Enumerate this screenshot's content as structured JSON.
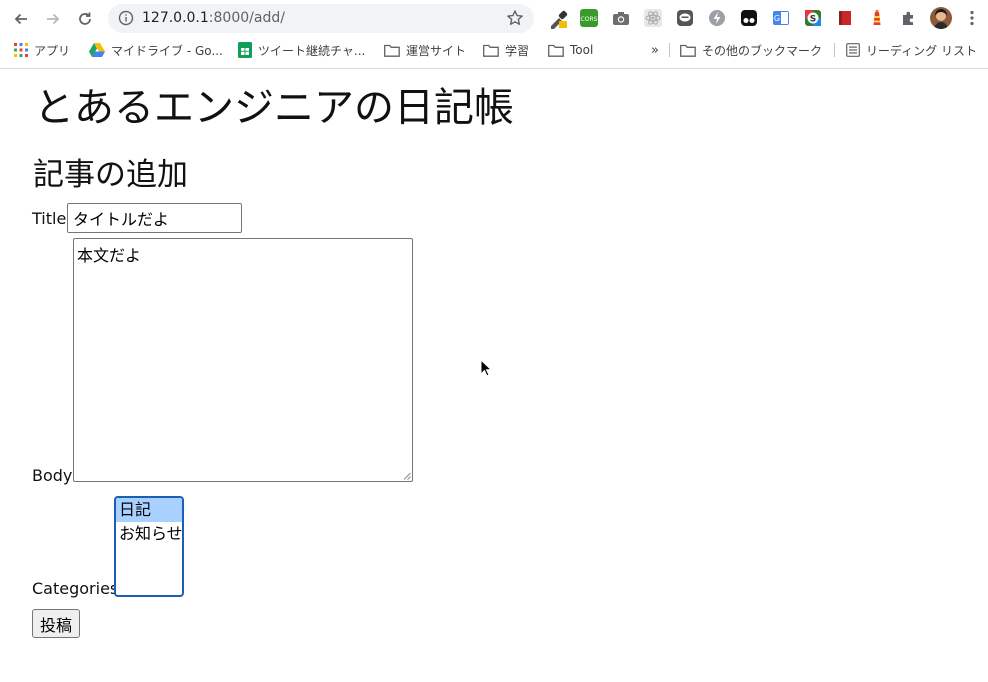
{
  "browser": {
    "url_host": "127.0.0.1",
    "url_path": ":8000/add/",
    "bookmarks": [
      {
        "label": "アプリ",
        "icon": "apps-grid-icon"
      },
      {
        "label": "マイドライブ - Go...",
        "icon": "google-drive-icon"
      },
      {
        "label": "ツイート継続チャ...",
        "icon": "google-sheets-icon"
      },
      {
        "label": "運営サイト",
        "icon": "folder-icon"
      },
      {
        "label": "学習",
        "icon": "folder-icon"
      },
      {
        "label": "Tool",
        "icon": "folder-icon"
      }
    ],
    "overflow_label": "»",
    "other_bookmarks_label": "その他のブックマーク",
    "reading_list_label": "リーディング リスト",
    "colors": {
      "toolbar_bg": "#ffffff",
      "omnibox_bg": "#f1f3f4"
    }
  },
  "page": {
    "site_title": "とあるエンジニアの日記帳",
    "section_title": "記事の追加",
    "form": {
      "title_label": "Title",
      "title_value": "タイトルだよ",
      "body_label": "Body",
      "body_value": "本文だよ",
      "categories_label": "Categories",
      "categories": [
        {
          "label": "日記",
          "selected": true
        },
        {
          "label": "お知らせ",
          "selected": false
        }
      ],
      "submit_label": "投稿"
    },
    "colors": {
      "selected_option_bg": "#a8d1ff",
      "focus_ring": "#1a5fb4"
    }
  }
}
